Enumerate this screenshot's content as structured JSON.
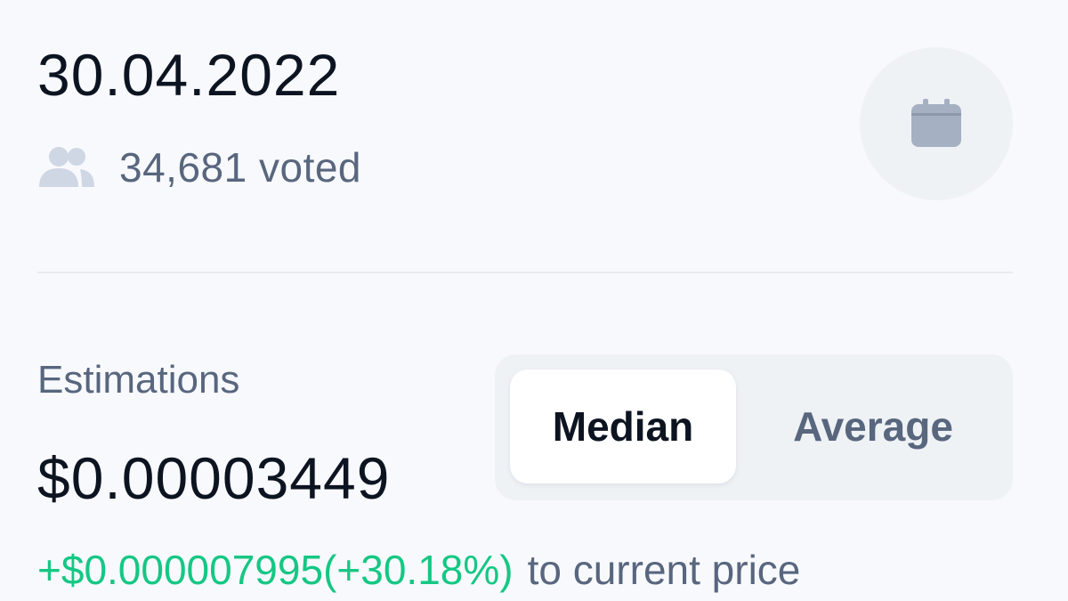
{
  "header": {
    "date": "30.04.2022",
    "voted_count": "34,681",
    "voted_suffix": "voted",
    "icons": {
      "voters": "users-icon",
      "calendar": "calendar-icon"
    }
  },
  "estimations": {
    "label": "Estimations",
    "value": "$0.00003449",
    "toggle": {
      "options": [
        "Median",
        "Average"
      ],
      "selected": "Median"
    },
    "change": {
      "amount": "+$0.000007995",
      "percent": "(+30.18%)",
      "suffix": "to current price"
    }
  },
  "colors": {
    "text_primary": "#0d1421",
    "text_secondary": "#58667e",
    "positive": "#16c784",
    "background": "#f8f9fc",
    "chip_background": "#eff2f5"
  }
}
